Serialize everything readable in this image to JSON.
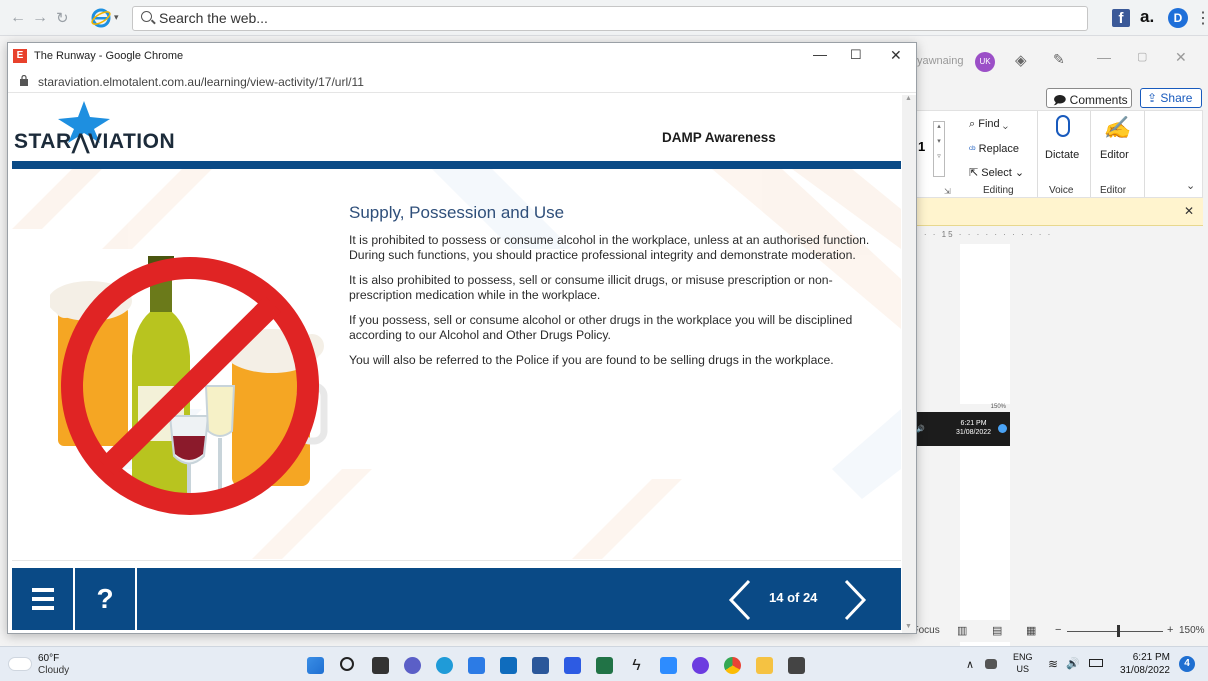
{
  "outer_browser": {
    "search_placeholder": "Search the web..."
  },
  "word": {
    "user_name": "yawnaing",
    "avatar_initials": "UK",
    "comments_label": "Comments",
    "share_label": "Share",
    "font_size_value": "1",
    "find_label": "Find",
    "replace_label": "Replace",
    "select_label": "Select",
    "dictate_label": "Dictate",
    "editor_label": "Editor",
    "group_editing": "Editing",
    "group_voice": "Voice",
    "group_editor": "Editor",
    "ruler_mark": "15",
    "focus_label": "Focus",
    "zoom_level": "150%",
    "mini_zoom": "150%",
    "mini_time": "6:21 PM",
    "mini_date": "31/08/2022"
  },
  "chrome": {
    "window_title": "The Runway - Google Chrome",
    "url": "staraviation.elmotalent.com.au/learning/view-activity/17/url/11"
  },
  "slide": {
    "logo_text_left": "STAR",
    "logo_text_right": "VIATION",
    "course_title": "DAMP Awareness",
    "heading": "Supply, Possession and Use",
    "paragraphs": [
      "It is prohibited to possess or consume alcohol in the workplace, unless at an authorised function. During such functions, you should practice professional integrity and demonstrate moderation.",
      "It is also prohibited to possess, sell or consume illicit drugs, or misuse prescription or non-prescription medication while in the workplace.",
      "If you possess, sell or consume alcohol or other drugs in the workplace you will be disciplined according to our Alcohol and Other Drugs Policy.",
      "You will also be referred to the Police if you are found to be selling drugs in the workplace."
    ],
    "help_glyph": "?",
    "page_indicator": "14 of 24"
  },
  "taskbar": {
    "weather_temp": "60°F",
    "weather_desc": "Cloudy",
    "lang_top": "ENG",
    "lang_bottom": "US",
    "time": "6:21 PM",
    "date": "31/08/2022",
    "notification_count": "4"
  },
  "colors": {
    "brand_blue": "#0a4a86",
    "heading_blue": "#2f4f7a",
    "prohibit_red": "#e02424"
  }
}
